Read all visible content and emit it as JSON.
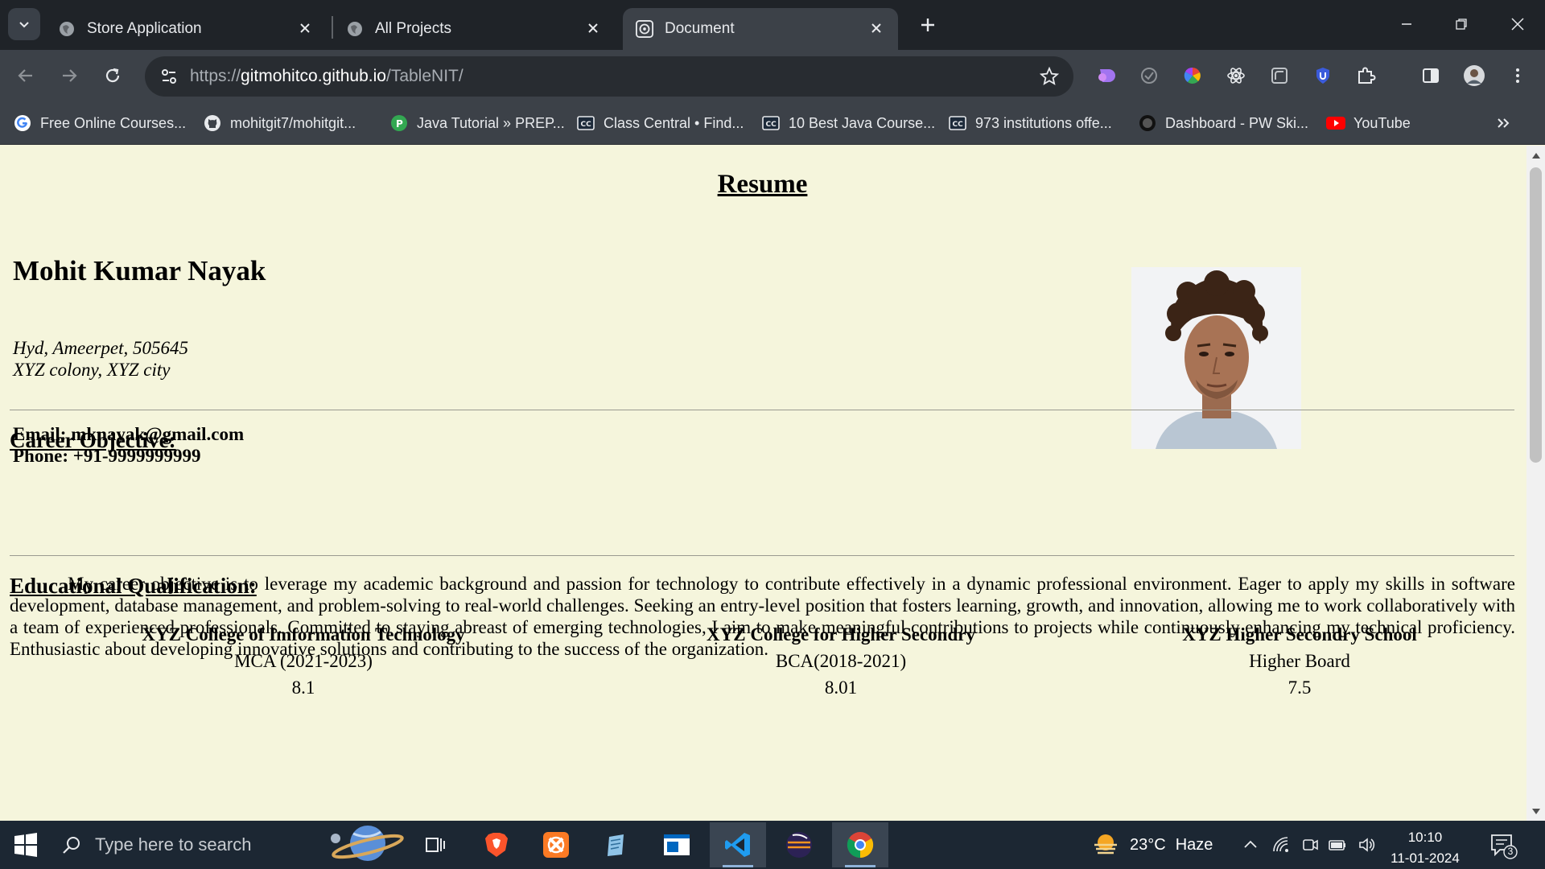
{
  "browser": {
    "tabs": [
      {
        "title": "Store Application",
        "active": false
      },
      {
        "title": "All Projects",
        "active": false
      },
      {
        "title": "Document",
        "active": true
      }
    ],
    "url": {
      "scheme": "https://",
      "host": "gitmohitco.github.io",
      "path": "/TableNIT/"
    },
    "bookmarks": [
      {
        "label": "Free Online Courses...",
        "icon": "google-icon"
      },
      {
        "label": "mohitgit7/mohitgit...",
        "icon": "github-icon"
      },
      {
        "label": "Java Tutorial » PREP...",
        "icon": "prepinsta-icon"
      },
      {
        "label": "Class Central • Find...",
        "icon": "class-central-icon"
      },
      {
        "label": "10 Best Java Course...",
        "icon": "class-central-icon"
      },
      {
        "label": "973 institutions offe...",
        "icon": "class-central-icon"
      },
      {
        "label": "Dashboard - PW Ski...",
        "icon": "pw-skills-icon"
      },
      {
        "label": "YouTube",
        "icon": "youtube-icon"
      }
    ]
  },
  "resume": {
    "title": "Resume",
    "name": "Mohit Kumar Nayak",
    "address_line1": "Hyd, Ameerpet, 505645",
    "address_line2": "XYZ colony, XYZ city",
    "email": "Email: mknayak@gmail.com",
    "phone": "Phone: +91-9999999999",
    "career_heading": "Career Objective:",
    "career_text": "My career objective is to leverage my academic background and passion for technology to contribute effectively in a dynamic professional environment. Eager to apply my skills in software development, database management, and problem-solving to real-world challenges. Seeking an entry-level position that fosters learning, growth, and innovation, allowing me to work collaboratively with a team of experienced professionals. Committed to staying abreast of emerging technologies, I aim to make meaningful contributions to projects while continuously enhancing my technical proficiency. Enthusiastic about developing innovative solutions and contributing to the success of the organization.",
    "education_heading": "Educational Qualification:",
    "education": [
      {
        "institution": "XYZ College of Imformation Technology",
        "degree": "MCA (2021-2023)",
        "score": "8.1"
      },
      {
        "institution": "XYZ College for Higher Secondry",
        "degree": "BCA(2018-2021)",
        "score": "8.01"
      },
      {
        "institution": "XYZ Higher Secondry School",
        "degree": "Higher Board",
        "score": "7.5"
      }
    ]
  },
  "taskbar": {
    "search_placeholder": "Type here to search",
    "weather": {
      "temp": "23°C",
      "condition": "Haze"
    },
    "time": "10:10",
    "date": "11-01-2024",
    "notification_count": "3"
  },
  "colors": {
    "page_background": "#f5f5dc",
    "tabstrip": "#1f2328",
    "toolbar": "#3c4148",
    "taskbar": "#1c2733"
  }
}
